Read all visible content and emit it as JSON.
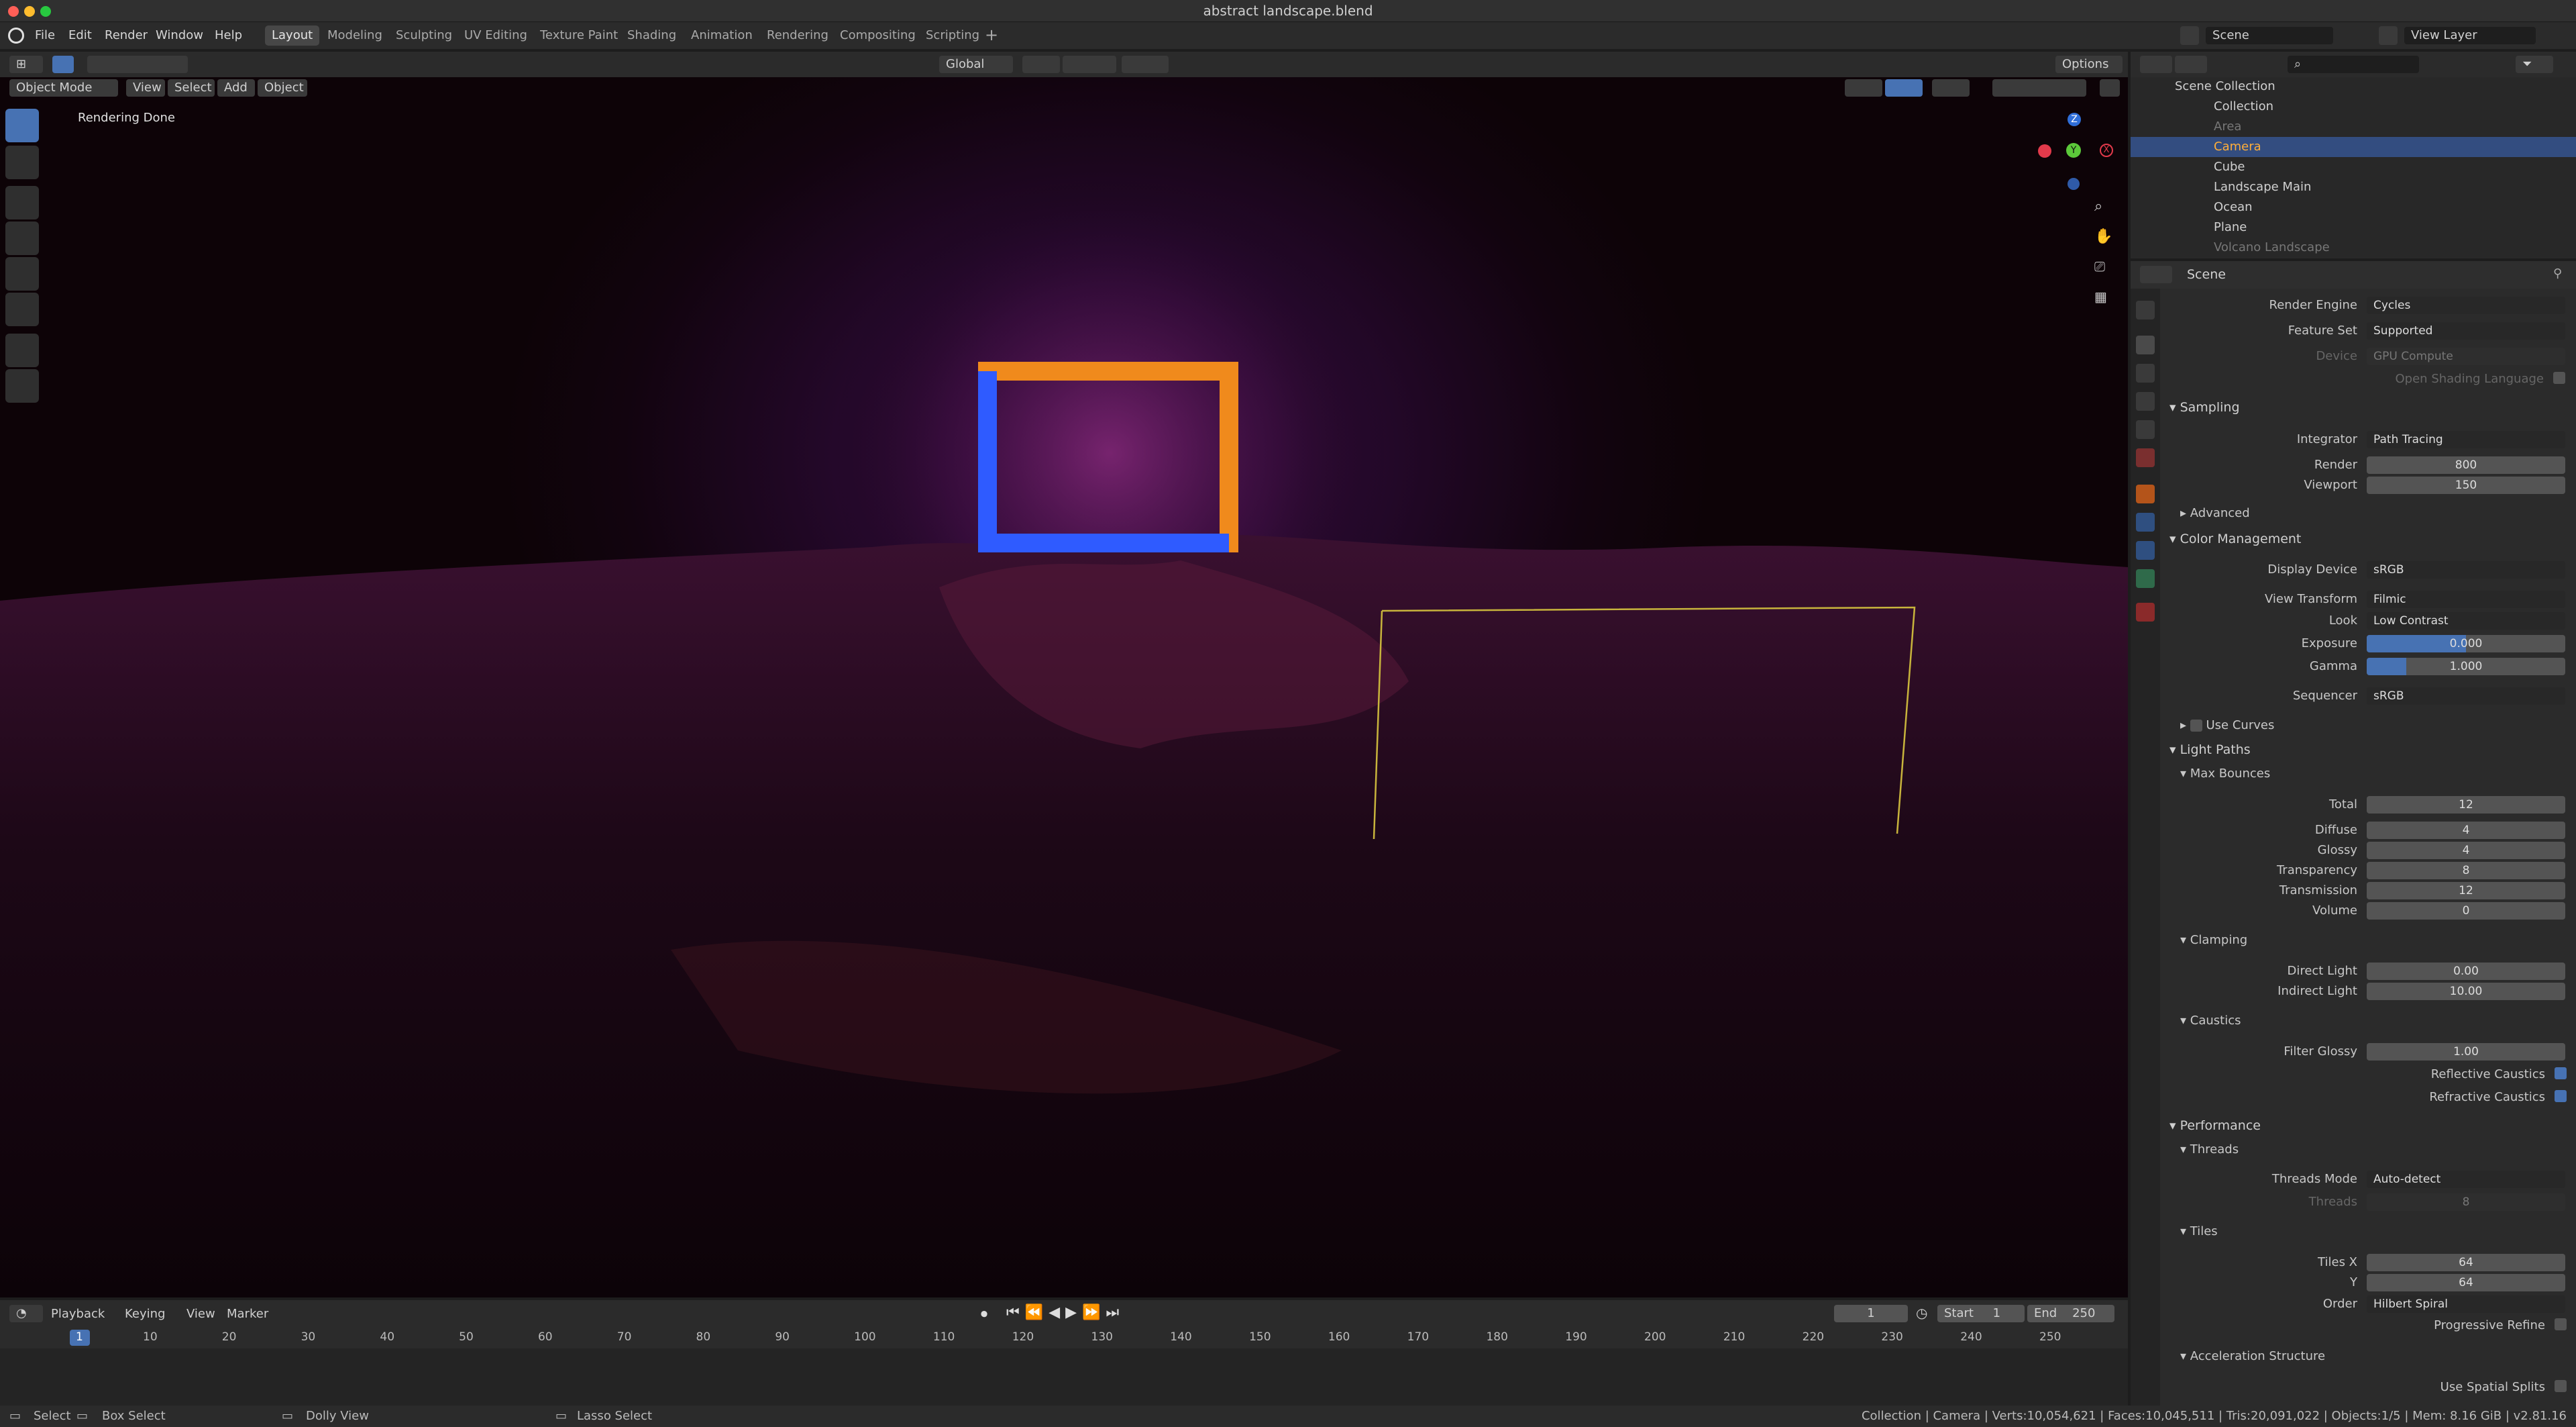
{
  "window": {
    "title": "abstract landscape.blend"
  },
  "menu": [
    "File",
    "Edit",
    "Render",
    "Window",
    "Help"
  ],
  "workspaces": [
    "Layout",
    "Modeling",
    "Sculpting",
    "UV Editing",
    "Texture Paint",
    "Shading",
    "Animation",
    "Rendering",
    "Compositing",
    "Scripting"
  ],
  "scene_selector": {
    "scene": "Scene",
    "view_layer": "View Layer"
  },
  "viewport": {
    "mode": "Object Mode",
    "menus": [
      "View",
      "Select",
      "Add",
      "Object"
    ],
    "transform_orientation": "Global",
    "options_label": "Options",
    "status_text": "Rendering Done",
    "axis_labels": {
      "z": "Z",
      "y": "Y",
      "x": "X"
    }
  },
  "outliner": {
    "root": "Scene Collection",
    "collection": "Collection",
    "items": [
      "Area",
      "Camera",
      "Cube",
      "Landscape Main",
      "Ocean",
      "Plane",
      "Volcano Landscape"
    ],
    "search_placeholder": ""
  },
  "properties": {
    "header": "Scene",
    "render_engine_label": "Render Engine",
    "render_engine": "Cycles",
    "feature_set_label": "Feature Set",
    "feature_set": "Supported",
    "device_label": "Device",
    "device": "GPU Compute",
    "osl_label": "Open Shading Language",
    "sampling": {
      "title": "Sampling",
      "integrator_label": "Integrator",
      "integrator": "Path Tracing",
      "render_label": "Render",
      "render": "800",
      "viewport_label": "Viewport",
      "viewport": "150",
      "advanced": "Advanced"
    },
    "color_management": {
      "title": "Color Management",
      "display_device_label": "Display Device",
      "display_device": "sRGB",
      "view_transform_label": "View Transform",
      "view_transform": "Filmic",
      "look_label": "Look",
      "look": "Low Contrast",
      "exposure_label": "Exposure",
      "exposure": "0.000",
      "gamma_label": "Gamma",
      "gamma": "1.000",
      "sequencer_label": "Sequencer",
      "sequencer": "sRGB",
      "use_curves": "Use Curves"
    },
    "light_paths": {
      "title": "Light Paths",
      "max_bounces": "Max Bounces",
      "total_label": "Total",
      "total": "12",
      "diffuse_label": "Diffuse",
      "diffuse": "4",
      "glossy_label": "Glossy",
      "glossy": "4",
      "transparency_label": "Transparency",
      "transparency": "8",
      "transmission_label": "Transmission",
      "transmission": "12",
      "volume_label": "Volume",
      "volume": "0",
      "clamping": "Clamping",
      "direct_light_label": "Direct Light",
      "direct_light": "0.00",
      "indirect_light_label": "Indirect Light",
      "indirect_light": "10.00",
      "caustics": "Caustics",
      "filter_glossy_label": "Filter Glossy",
      "filter_glossy": "1.00",
      "reflective_label": "Reflective Caustics",
      "refractive_label": "Refractive Caustics"
    },
    "performance": {
      "title": "Performance",
      "threads": "Threads",
      "threads_mode_label": "Threads Mode",
      "threads_mode": "Auto-detect",
      "threads_label": "Threads",
      "threads_value": "8",
      "tiles": "Tiles",
      "tiles_x_label": "Tiles X",
      "tiles_x": "64",
      "y_label": "Y",
      "tiles_y": "64",
      "order_label": "Order",
      "order": "Hilbert Spiral",
      "progressive_label": "Progressive Refine",
      "accel": "Acceleration Structure",
      "spatial_label": "Use Spatial Splits"
    }
  },
  "timeline": {
    "menus": [
      "Playback",
      "Keying",
      "View",
      "Marker"
    ],
    "current_frame": "1",
    "start_label": "Start",
    "start": "1",
    "end_label": "End",
    "end": "250",
    "ticks": [
      "1",
      "10",
      "20",
      "30",
      "40",
      "50",
      "60",
      "70",
      "80",
      "90",
      "100",
      "110",
      "120",
      "130",
      "140",
      "150",
      "160",
      "170",
      "180",
      "190",
      "200",
      "210",
      "220",
      "230",
      "240",
      "250"
    ]
  },
  "statusbar": {
    "select": "Select",
    "box_select": "Box Select",
    "dolly_view": "Dolly View",
    "lasso_select": "Lasso Select",
    "info": "Collection | Camera | Verts:10,054,621 | Faces:10,045,511 | Tris:20,091,022 | Objects:1/5 | Mem: 8.16 GiB | v2.81.16"
  },
  "colors": {
    "accent": "#4772b3",
    "selection": "#334d80",
    "frame_orange": "#f08a1c",
    "frame_blue": "#2f5bff",
    "camera_outline": "#c8b43c"
  }
}
